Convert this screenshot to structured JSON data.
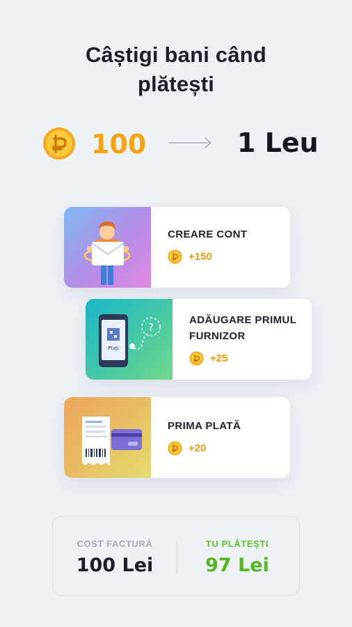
{
  "header": {
    "title_line1": "Câștigi bani când",
    "title_line2": "plătești"
  },
  "rate": {
    "coin_icon": "ruble-coin-icon",
    "points": "100",
    "arrow_icon": "arrow-right-icon",
    "money": "1 Leu"
  },
  "tasks": [
    {
      "label": "CREARE CONT",
      "points": "+150",
      "icon": "user-envelope-illustration"
    },
    {
      "label_line1": "ADĂUGARE PRIMUL",
      "label_line2": "FURNIZOR",
      "points": "+25",
      "icon": "phone-qr-illustration",
      "qr_caption": "Plaţi",
      "question_mark": "?"
    },
    {
      "label": "PRIMA PLATĂ",
      "points": "+20",
      "icon": "receipt-card-illustration"
    }
  ],
  "summary": {
    "cost_label": "COST FACTURĂ",
    "cost_value": "100 Lei",
    "pay_label": "TU PLĂTEȘTI",
    "pay_value": "97 Lei"
  },
  "colors": {
    "background": "#eef1f6",
    "accent_orange": "#f4a414",
    "accent_green": "#56b524",
    "text_dark": "#1b1f2a",
    "text_muted": "#a6abb8"
  }
}
